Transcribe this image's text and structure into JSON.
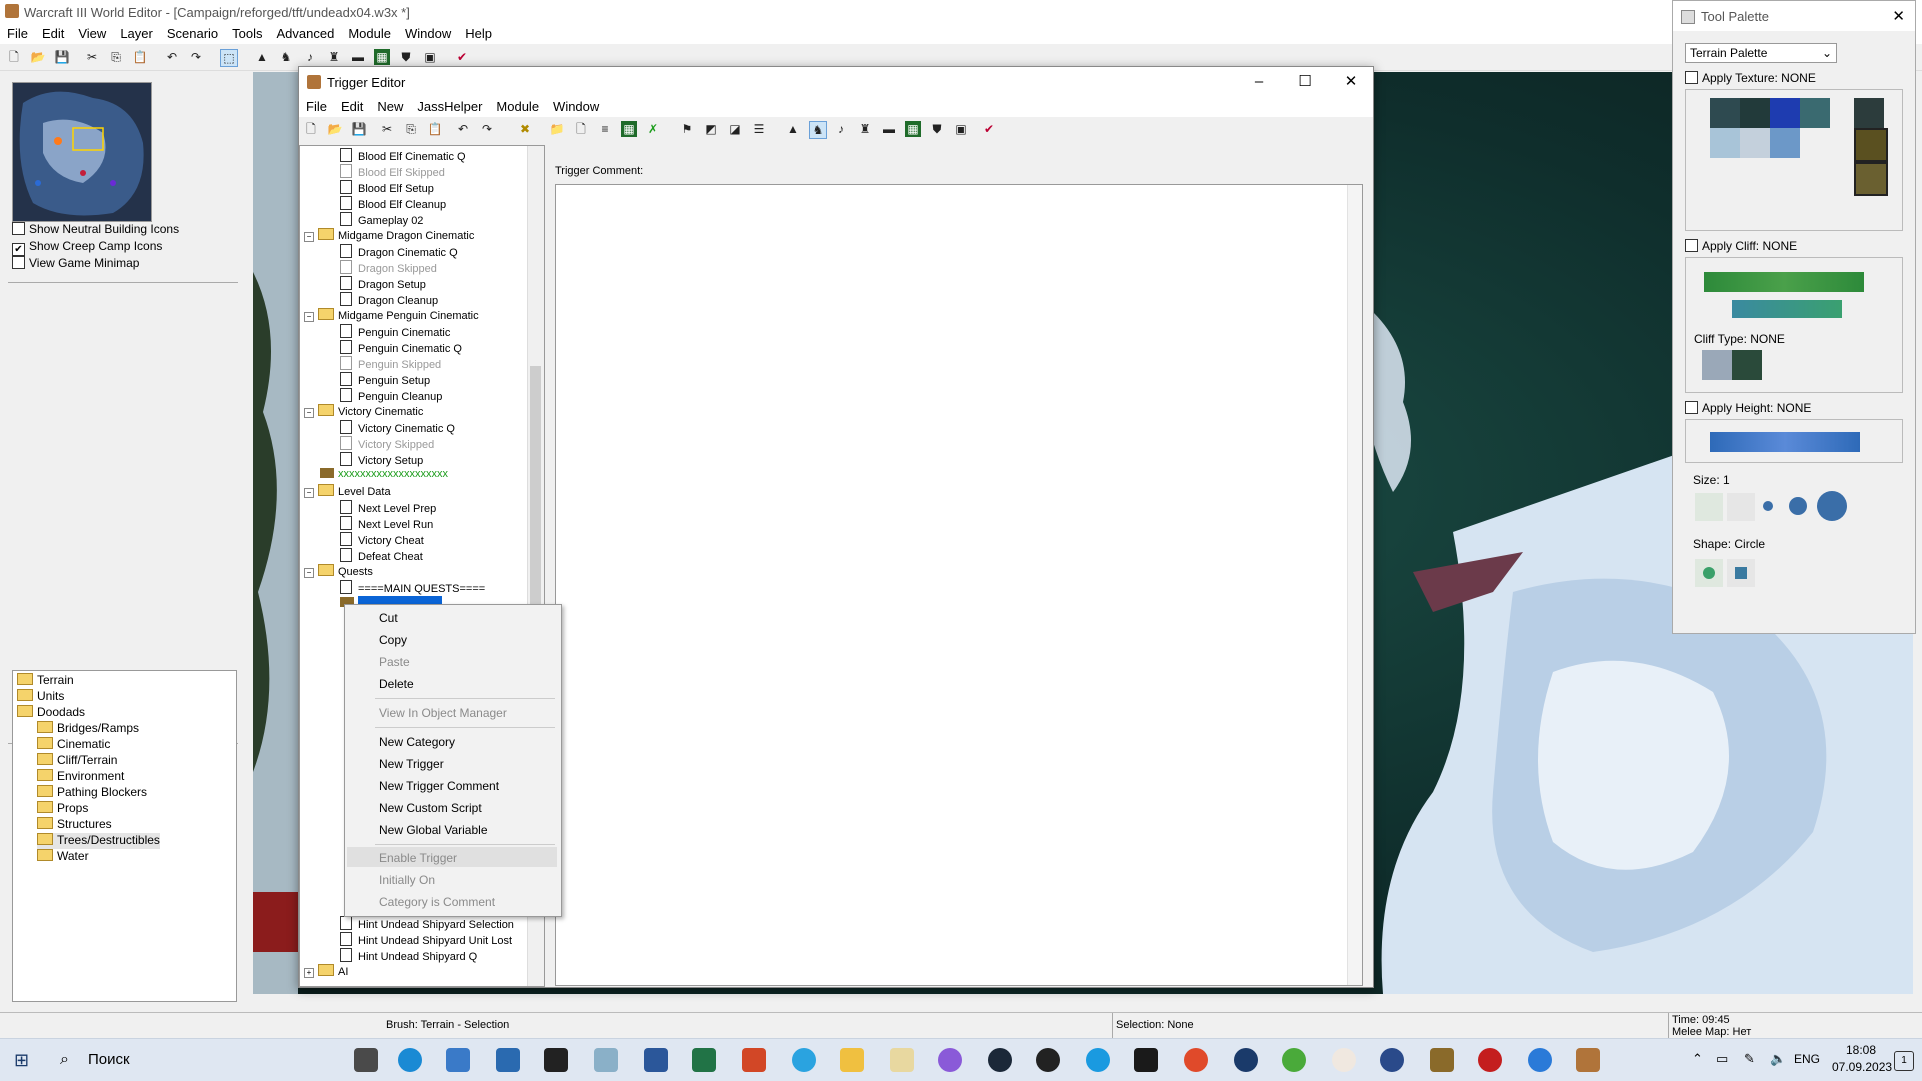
{
  "app": {
    "title": "Warcraft III World Editor - [Campaign/reforged/tft/undeadx04.w3x *]",
    "menu": [
      "File",
      "Edit",
      "View",
      "Layer",
      "Scenario",
      "Tools",
      "Advanced",
      "Module",
      "Window",
      "Help"
    ]
  },
  "left_panel": {
    "checkboxes": [
      {
        "label": "Show Neutral Building Icons",
        "checked": false
      },
      {
        "label": "Show Creep Camp Icons",
        "checked": true
      },
      {
        "label": "View Game Minimap",
        "checked": false
      }
    ],
    "palette_tree": [
      {
        "label": "Terrain",
        "indent": 0
      },
      {
        "label": "Units",
        "indent": 0
      },
      {
        "label": "Doodads",
        "indent": 0
      },
      {
        "label": "Bridges/Ramps",
        "indent": 1
      },
      {
        "label": "Cinematic",
        "indent": 1
      },
      {
        "label": "Cliff/Terrain",
        "indent": 1
      },
      {
        "label": "Environment",
        "indent": 1
      },
      {
        "label": "Pathing Blockers",
        "indent": 1
      },
      {
        "label": "Props",
        "indent": 1
      },
      {
        "label": "Structures",
        "indent": 1
      },
      {
        "label": "Trees/Destructibles",
        "indent": 1
      },
      {
        "label": "Water",
        "indent": 1
      }
    ]
  },
  "trigger_editor": {
    "title": "Trigger Editor",
    "menu": [
      "File",
      "Edit",
      "New",
      "JassHelper",
      "Module",
      "Window"
    ],
    "comment_label": "Trigger Comment:",
    "tree": [
      {
        "label": "Blood Elf Cinematic Q",
        "type": "trigger",
        "level": 2,
        "disabled": false
      },
      {
        "label": "Blood Elf Skipped",
        "type": "trigger",
        "level": 2,
        "disabled": true
      },
      {
        "label": "Blood Elf Setup",
        "type": "trigger",
        "level": 2,
        "disabled": false
      },
      {
        "label": "Blood Elf Cleanup",
        "type": "trigger",
        "level": 2,
        "disabled": false
      },
      {
        "label": "Gameplay 02",
        "type": "trigger",
        "level": 2,
        "disabled": false
      },
      {
        "label": "Midgame Dragon Cinematic",
        "type": "category",
        "level": 1,
        "disabled": false
      },
      {
        "label": "Dragon Cinematic Q",
        "type": "trigger",
        "level": 2,
        "disabled": false
      },
      {
        "label": "Dragon Skipped",
        "type": "trigger",
        "level": 2,
        "disabled": true
      },
      {
        "label": "Dragon Setup",
        "type": "trigger",
        "level": 2,
        "disabled": false
      },
      {
        "label": "Dragon Cleanup",
        "type": "trigger",
        "level": 2,
        "disabled": false
      },
      {
        "label": "Midgame Penguin Cinematic",
        "type": "category",
        "level": 1,
        "disabled": false
      },
      {
        "label": "Penguin Cinematic",
        "type": "trigger",
        "level": 2,
        "disabled": false
      },
      {
        "label": "Penguin Cinematic Q",
        "type": "trigger",
        "level": 2,
        "disabled": false
      },
      {
        "label": "Penguin Skipped",
        "type": "trigger",
        "level": 2,
        "disabled": true
      },
      {
        "label": "Penguin Setup",
        "type": "trigger",
        "level": 2,
        "disabled": false
      },
      {
        "label": "Penguin Cleanup",
        "type": "trigger",
        "level": 2,
        "disabled": false
      },
      {
        "label": "Victory Cinematic",
        "type": "category",
        "level": 1,
        "disabled": false
      },
      {
        "label": "Victory Cinematic Q",
        "type": "trigger",
        "level": 2,
        "disabled": false
      },
      {
        "label": "Victory Skipped",
        "type": "trigger",
        "level": 2,
        "disabled": true
      },
      {
        "label": "Victory Setup",
        "type": "trigger",
        "level": 2,
        "disabled": false
      },
      {
        "label": "xxxxxxxxxxxxxxxxxxxx",
        "type": "comment",
        "level": 1,
        "disabled": false
      },
      {
        "label": "Level Data",
        "type": "category",
        "level": 1,
        "disabled": false
      },
      {
        "label": "Next Level Prep",
        "type": "trigger",
        "level": 2,
        "disabled": false
      },
      {
        "label": "Next Level Run",
        "type": "trigger",
        "level": 2,
        "disabled": false
      },
      {
        "label": "Victory Cheat",
        "type": "trigger",
        "level": 2,
        "disabled": false
      },
      {
        "label": "Defeat Cheat",
        "type": "trigger",
        "level": 2,
        "disabled": false
      },
      {
        "label": "Quests",
        "type": "category",
        "level": 1,
        "disabled": false
      },
      {
        "label": "====MAIN QUESTS====",
        "type": "trigger",
        "level": 2,
        "disabled": false
      }
    ],
    "tree_bottom": [
      {
        "label": "Hint Undead Shipyard Selection",
        "type": "trigger",
        "level": 2
      },
      {
        "label": "Hint Undead Shipyard Unit Lost",
        "type": "trigger",
        "level": 2
      },
      {
        "label": "Hint Undead Shipyard Q",
        "type": "trigger",
        "level": 2
      },
      {
        "label": "AI",
        "type": "category",
        "level": 1
      }
    ]
  },
  "context_menu": {
    "groups": [
      [
        {
          "label": "Cut",
          "enabled": true
        },
        {
          "label": "Copy",
          "enabled": true
        },
        {
          "label": "Paste",
          "enabled": false
        },
        {
          "label": "Delete",
          "enabled": true
        }
      ],
      [
        {
          "label": "View In Object Manager",
          "enabled": false
        }
      ],
      [
        {
          "label": "New Category",
          "enabled": true
        },
        {
          "label": "New Trigger",
          "enabled": true
        },
        {
          "label": "New Trigger Comment",
          "enabled": true
        },
        {
          "label": "New Custom Script",
          "enabled": true
        },
        {
          "label": "New Global Variable",
          "enabled": true
        }
      ],
      [
        {
          "label": "Enable Trigger",
          "enabled": false
        },
        {
          "label": "Initially On",
          "enabled": false
        },
        {
          "label": "Category is Comment",
          "enabled": false
        }
      ]
    ]
  },
  "tool_palette": {
    "title": "Tool Palette",
    "dropdown": "Terrain Palette",
    "apply_texture": "Apply Texture: NONE",
    "apply_cliff": "Apply Cliff: NONE",
    "cliff_type": "Cliff Type: NONE",
    "apply_height": "Apply Height: NONE",
    "size": "Size: 1",
    "shape": "Shape: Circle"
  },
  "status": {
    "brush": "Brush: Terrain - Selection",
    "selection": "Selection: None",
    "time": "Time: 09:45",
    "melee": "Melee Map: Нет"
  },
  "taskbar": {
    "search": "Поиск",
    "lang": "ENG",
    "time": "18:08",
    "date": "07.09.2023",
    "notif": "1"
  }
}
